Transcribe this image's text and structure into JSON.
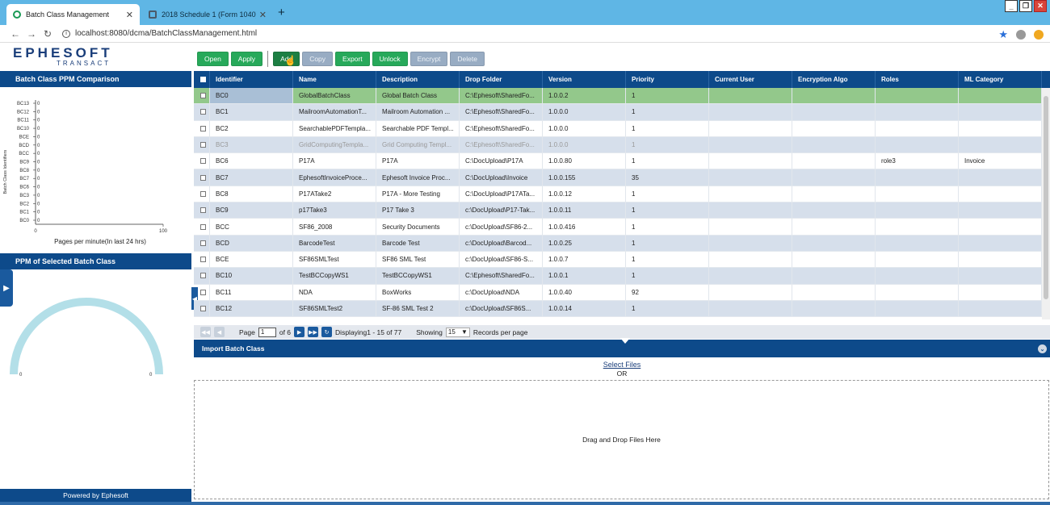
{
  "browser": {
    "tabs": [
      {
        "title": "Batch Class Management",
        "active": true
      },
      {
        "title": "2018 Schedule 1 (Form 1040)",
        "active": false
      }
    ],
    "url": "localhost:8080/dcma/BatchClassManagement.html"
  },
  "app": {
    "logo_main": "EPHESOFT",
    "logo_sub": "TRANSACT",
    "toolbar": [
      "Open",
      "Apply",
      "Add",
      "Copy",
      "Export",
      "Unlock",
      "Encrypt",
      "Delete"
    ]
  },
  "left": {
    "ppm_title": "Batch Class PPM Comparison",
    "ppm_chart": {
      "type": "bar",
      "categories": [
        "BC13",
        "BC12",
        "BC11",
        "BC10",
        "BCE",
        "BCD",
        "BCC",
        "BC9",
        "BC8",
        "BC7",
        "BC6",
        "BC3",
        "BC2",
        "BC1",
        "BC0"
      ],
      "values": [
        0,
        0,
        0,
        0,
        0,
        0,
        0,
        0,
        0,
        0,
        0,
        0,
        0,
        0,
        0
      ],
      "xlabel": "Pages per minute(In last 24 hrs)",
      "ylabel": "Batch Class Identifiers",
      "xlim": [
        0,
        100
      ],
      "xticks": [
        "0",
        "100"
      ]
    },
    "selected_title": "PPM of Selected Batch Class",
    "gauge_min": "0",
    "gauge_max": "0",
    "powered": "Powered by Ephesoft"
  },
  "grid": {
    "columns": [
      "Identifier",
      "Name",
      "Description",
      "Drop Folder",
      "Version",
      "Priority",
      "Current User",
      "Encryption Algo",
      "Roles",
      "ML Category"
    ],
    "rows": [
      [
        "BC0",
        "GlobalBatchClass",
        "Global Batch Class",
        "C:\\Ephesoft\\SharedFo...",
        "1.0.0.2",
        "1",
        "",
        "",
        "",
        ""
      ],
      [
        "BC1",
        "MailroomAutomationT...",
        "Mailroom Automation ...",
        "C:\\Ephesoft\\SharedFo...",
        "1.0.0.0",
        "1",
        "",
        "",
        "",
        ""
      ],
      [
        "BC2",
        "SearchablePDFTempla...",
        "Searchable PDF Templ...",
        "C:\\Ephesoft\\SharedFo...",
        "1.0.0.0",
        "1",
        "",
        "",
        "",
        ""
      ],
      [
        "BC3",
        "GridComputingTempla...",
        "Grid Computing Templ...",
        "C:\\Ephesoft\\SharedFo...",
        "1.0.0.0",
        "1",
        "",
        "",
        "",
        ""
      ],
      [
        "BC6",
        "P17A",
        "P17A",
        "C:\\DocUpload\\P17A",
        "1.0.0.80",
        "1",
        "",
        "",
        "role3",
        "Invoice"
      ],
      [
        "BC7",
        "EphesoftInvoiceProce...",
        "Ephesoft Invoice Proc...",
        "C:\\DocUpload\\Invoice",
        "1.0.0.155",
        "35",
        "",
        "",
        "",
        ""
      ],
      [
        "BC8",
        "P17ATake2",
        "P17A - More Testing",
        "C:\\DocUpload\\P17ATa...",
        "1.0.0.12",
        "1",
        "",
        "",
        "",
        ""
      ],
      [
        "BC9",
        "p17Take3",
        "P17 Take 3",
        "c:\\DocUpload\\P17-Tak...",
        "1.0.0.11",
        "1",
        "",
        "",
        "",
        ""
      ],
      [
        "BCC",
        "SF86_2008",
        "Security Documents",
        "c:\\DocUpload\\SF86-2...",
        "1.0.0.416",
        "1",
        "",
        "",
        "",
        ""
      ],
      [
        "BCD",
        "BarcodeTest",
        "Barcode Test",
        "c:\\DocUpload\\Barcod...",
        "1.0.0.25",
        "1",
        "",
        "",
        "",
        ""
      ],
      [
        "BCE",
        "SF86SMLTest",
        "SF86 SML Test",
        "c:\\DocUpload\\SF86-S...",
        "1.0.0.7",
        "1",
        "",
        "",
        "",
        ""
      ],
      [
        "BC10",
        "TestBCCopyWS1",
        "TestBCCopyWS1",
        "C:\\Ephesoft\\SharedFo...",
        "1.0.0.1",
        "1",
        "",
        "",
        "",
        ""
      ],
      [
        "BC11",
        "NDA",
        "BoxWorks",
        "c:\\DocUpload\\NDA",
        "1.0.0.40",
        "92",
        "",
        "",
        "",
        ""
      ],
      [
        "BC12",
        "SF86SMLTest2",
        "SF-86 SML Test 2",
        "c:\\DocUpload\\SF86S...",
        "1.0.0.14",
        "1",
        "",
        "",
        "",
        ""
      ]
    ],
    "selected_row": 0,
    "disabled_row": 3
  },
  "pager": {
    "page_label": "Page",
    "page_value": "1",
    "of_label": "of 6",
    "displaying": "Displaying1 - 15 of 77",
    "showing_label": "Showing",
    "showing_value": "15",
    "records_label": "Records per page"
  },
  "import": {
    "title": "Import Batch Class",
    "select_files": "Select Files",
    "or": "OR",
    "drop_text": "Drag and Drop Files Here"
  }
}
